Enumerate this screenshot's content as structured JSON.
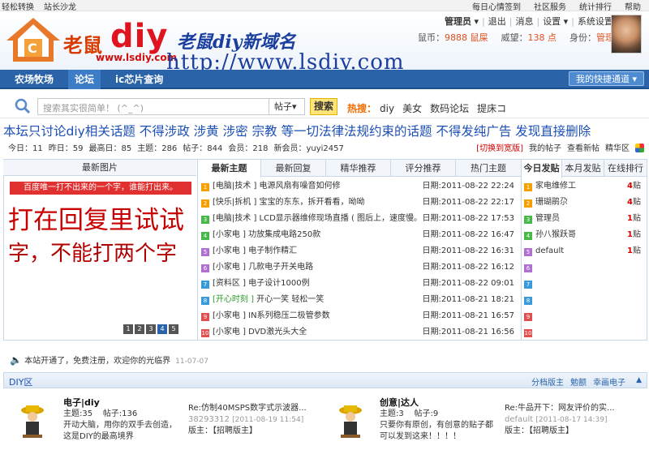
{
  "topbar": {
    "left": [
      "轻松转换",
      "站长沙龙"
    ],
    "right": [
      "每日心情签到",
      "社区服务",
      "统计排行",
      "帮助"
    ]
  },
  "header": {
    "logo_cn": "老鼠",
    "logo_diy": "diy",
    "logo_url": "www.lsdiy.com",
    "slogan1": "老鼠diy新域名",
    "slogan2": "http://www.lsdiy.com",
    "user_menu": {
      "manager": "管理员",
      "items": [
        "退出",
        "消息",
        "设置",
        "系统设置"
      ]
    },
    "user_info": {
      "coin_label": "鼠币：",
      "coin_value": "9888 鼠屎",
      "prestige_label": "威望：",
      "prestige_value": "138 点",
      "role_label": "身份：",
      "role_value": "管理员"
    }
  },
  "nav": {
    "items": [
      "农场牧场",
      "论坛",
      "ic芯片查询"
    ],
    "active": "论坛",
    "quick": "我的快捷通道 ▾"
  },
  "search": {
    "placeholder": "搜索其实很简单！ (^_^)",
    "type": "帖子▾",
    "button": "搜索",
    "hot_label": "热搜：",
    "hot": [
      "diy",
      "美女",
      "数码论坛",
      "提床コ"
    ]
  },
  "rules": "本坛只讨论diy相关话题 不得涉政 涉黄 涉密 宗教 等一切法律法规约束的话题 不得发纯广告 发现直接删除",
  "stats": {
    "today": "今日：11",
    "yesterday": "昨日：59",
    "max": "最高日：85",
    "threads": "主题：286",
    "posts": "帖子：844",
    "members": "会员：218",
    "newest": "新会员：yuyi2457",
    "switch": "[切换到宽版]",
    "my_posts": "我的帖子",
    "new_posts": "查看新帖",
    "digest": "精华区"
  },
  "latest_images": {
    "title": "最新图片",
    "banner": "百度唯一打不出来的一个字，谁能打出来。",
    "line1": "打在回复里试试",
    "line2": "字，不能打两个字",
    "pages": [
      "1",
      "2",
      "3",
      "4",
      "5"
    ]
  },
  "thread_tabs": [
    "最新主题",
    "最新回复",
    "精华推荐",
    "评分推荐",
    "热门主题"
  ],
  "threads": [
    {
      "num": "1",
      "cat": "[电脑|技术 ]",
      "title": "电源风扇有噪音如何修",
      "date": "日期:2011-08-22 22:24",
      "color": "#f5a000"
    },
    {
      "num": "2",
      "cat": "[快乐|拆机 ]",
      "title": "宝宝的东东，拆开看看，呦呦",
      "date": "日期:2011-08-22 22:17",
      "color": "#f5a000"
    },
    {
      "num": "3",
      "cat": "[电脑|技术 ]",
      "title": "LCD显示器维修现场直播 ( 图后上，速度慢。",
      "date": "日期:2011-08-22 17:53",
      "color": "#48b848"
    },
    {
      "num": "4",
      "cat": "[小家电 ]",
      "title": "功放集成电路250款",
      "date": "日期:2011-08-22 16:47",
      "color": "#48b848"
    },
    {
      "num": "5",
      "cat": "[小家电 ]",
      "title": "电子制作精汇",
      "date": "日期:2011-08-22 16:31",
      "color": "#b070d0"
    },
    {
      "num": "6",
      "cat": "[小家电 ]",
      "title": "几款电子开关电路",
      "date": "日期:2011-08-22 16:12",
      "color": "#b070d0"
    },
    {
      "num": "7",
      "cat": "[资料区 ]",
      "title": "电子设计1000例",
      "date": "日期:2011-08-22 09:01",
      "color": "#3a9ad9"
    },
    {
      "num": "8",
      "cat": "[开心时刻 ]",
      "title": "开心一笑 轻松一笑",
      "date": "日期:2011-08-21 18:21",
      "color": "#3a9ad9",
      "green": true
    },
    {
      "num": "9",
      "cat": "[小家电 ]",
      "title": "IN系列稳压二极管参数",
      "date": "日期:2011-08-21 16:57",
      "color": "#e05050"
    },
    {
      "num": "10",
      "cat": "[小家电 ]",
      "title": "DVD激光头大全",
      "date": "日期:2011-08-21 16:56",
      "color": "#e05050"
    }
  ],
  "rank_tabs": [
    "今日发贴",
    "本月发贴",
    "在线排行"
  ],
  "rank": [
    {
      "num": "1",
      "name": "家电维修工",
      "count": "4",
      "unit": "贴",
      "color": "#f5a000"
    },
    {
      "num": "2",
      "name": "珊瑚鹃尕",
      "count": "4",
      "unit": "贴",
      "color": "#f5a000"
    },
    {
      "num": "3",
      "name": "管理员",
      "count": "1",
      "unit": "贴",
      "color": "#48b848"
    },
    {
      "num": "4",
      "name": "孙八猴跃哥",
      "count": "1",
      "unit": "贴",
      "color": "#48b848"
    },
    {
      "num": "5",
      "name": "default",
      "count": "1",
      "unit": "贴",
      "color": "#b070d0"
    },
    {
      "num": "6",
      "name": "",
      "count": "",
      "unit": "",
      "color": "#b070d0"
    },
    {
      "num": "7",
      "name": "",
      "count": "",
      "unit": "",
      "color": "#3a9ad9"
    },
    {
      "num": "8",
      "name": "",
      "count": "",
      "unit": "",
      "color": "#3a9ad9"
    },
    {
      "num": "9",
      "name": "",
      "count": "",
      "unit": "",
      "color": "#e05050"
    },
    {
      "num": "10",
      "name": "",
      "count": "",
      "unit": "",
      "color": "#e05050"
    }
  ],
  "announcement": {
    "text": "本站开通了，免费注册，欢迎你的光临界",
    "date": "11-07-07"
  },
  "section": {
    "title": "DIY区",
    "links": [
      "分档版主",
      "勉额",
      "幸画电子"
    ],
    "up": "▲"
  },
  "forums": [
    {
      "name": "电子|diy",
      "threads": "主题:35",
      "posts": "帖子:136",
      "desc1": "开动大脑，用你的双手去创造，",
      "desc2": "这是DIY的最高境界",
      "last_title": "Re:仿制40MSPS数字式示波器...",
      "last_user": "38293312",
      "last_date": "[2011-08-19 11:54]",
      "mod_label": "版主：",
      "mod": "【招聘版主】"
    },
    {
      "name": "创意|达人",
      "threads": "主题:3",
      "posts": "帖子:9",
      "desc1": "只要你有原创，有创意的贴子都",
      "desc2": "可以发到这来！！！！",
      "last_title": "Re:牛品开下：网友评价的实...",
      "last_user": "default",
      "last_date": "[2011-08-17 14:39]",
      "mod_label": "版主：",
      "mod": "【招聘版主】"
    }
  ],
  "colors": {
    "nav": "#2a63a8",
    "link": "#1c4fb5",
    "accent": "#f26c00"
  }
}
